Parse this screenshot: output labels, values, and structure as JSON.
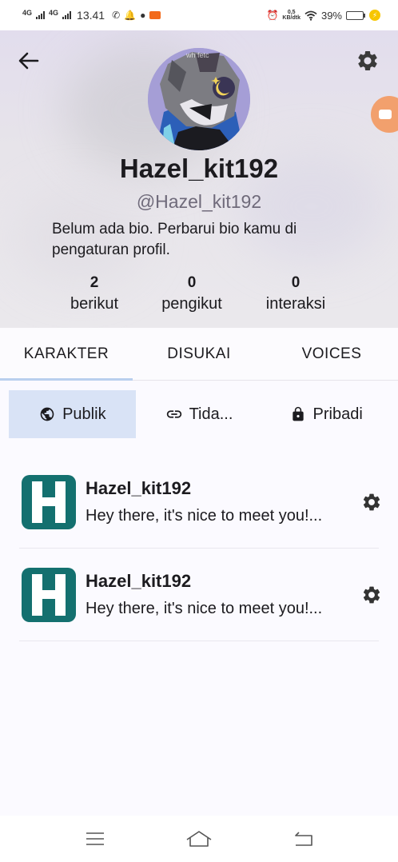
{
  "status_bar": {
    "network_1": "4G",
    "network_2": "4G",
    "time": "13.41",
    "speed_value": "0,5",
    "speed_unit": "KB/dtk",
    "battery": "39%",
    "battery_level": 0.39
  },
  "profile": {
    "name": "Hazel_kit192",
    "handle": "@Hazel_kit192",
    "bio": "Belum ada bio. Perbarui bio kamu di pengaturan profil.",
    "stats": [
      {
        "value": "2",
        "label": "berikut"
      },
      {
        "value": "0",
        "label": "pengikut"
      },
      {
        "value": "0",
        "label": "interaksi"
      }
    ]
  },
  "tabs": [
    {
      "label": "KARAKTER",
      "active": true
    },
    {
      "label": "DISUKAI",
      "active": false
    },
    {
      "label": "VOICES",
      "active": false
    }
  ],
  "filters": [
    {
      "label": "Publik",
      "icon": "globe-icon",
      "active": true
    },
    {
      "label": "Tida...",
      "icon": "link-icon",
      "active": false
    },
    {
      "label": "Pribadi",
      "icon": "lock-icon",
      "active": false
    }
  ],
  "characters": [
    {
      "name": "Hazel_kit192",
      "description": "Hey there, it's nice to meet you!...",
      "logo_letter": "H"
    },
    {
      "name": "Hazel_kit192",
      "description": "Hey there, it's nice to meet you!...",
      "logo_letter": "H"
    }
  ],
  "colors": {
    "accent": "#d9e3f6",
    "logo": "#14706f",
    "tab_indicator": "#b9cfee"
  }
}
